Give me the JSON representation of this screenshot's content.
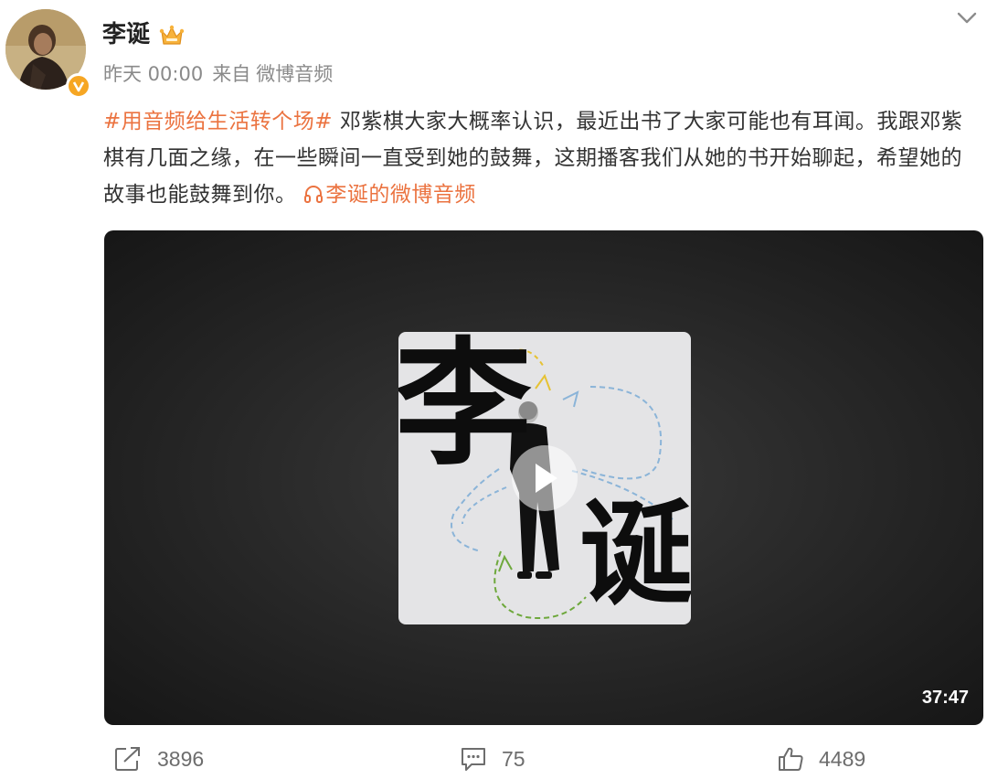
{
  "user": {
    "name": "李诞",
    "avatar_icon": "user-avatar",
    "badge_icon": "verified-v-badge",
    "member_icon": "crown-icon"
  },
  "meta": {
    "time": "昨天 00:00",
    "source_prefix": "来自",
    "source": "微博音频"
  },
  "post": {
    "hashtag": "#用音频给生活转个场#",
    "body": " 邓紫棋大家大概率认识，最近出书了大家可能也有耳闻。我跟邓紫棋有几面之缘，在一些瞬间一直受到她的鼓舞，这期播客我们从她的书开始聊起，希望她的故事也能鼓舞到你。 ",
    "audio_link_icon": "headphones-icon",
    "audio_link_text": "李诞的微博音频"
  },
  "media": {
    "cover_char_1": "李",
    "cover_char_2": "诞",
    "play_icon": "play-icon",
    "duration": "37:47"
  },
  "actions": {
    "repost_icon": "share-icon",
    "repost_count": "3896",
    "comment_icon": "comment-icon",
    "comment_count": "75",
    "like_icon": "thumbs-up-icon",
    "like_count": "4489"
  },
  "colors": {
    "accent": "#eb7340",
    "verified": "#f6a623",
    "meta_text": "#8a8a8a"
  }
}
